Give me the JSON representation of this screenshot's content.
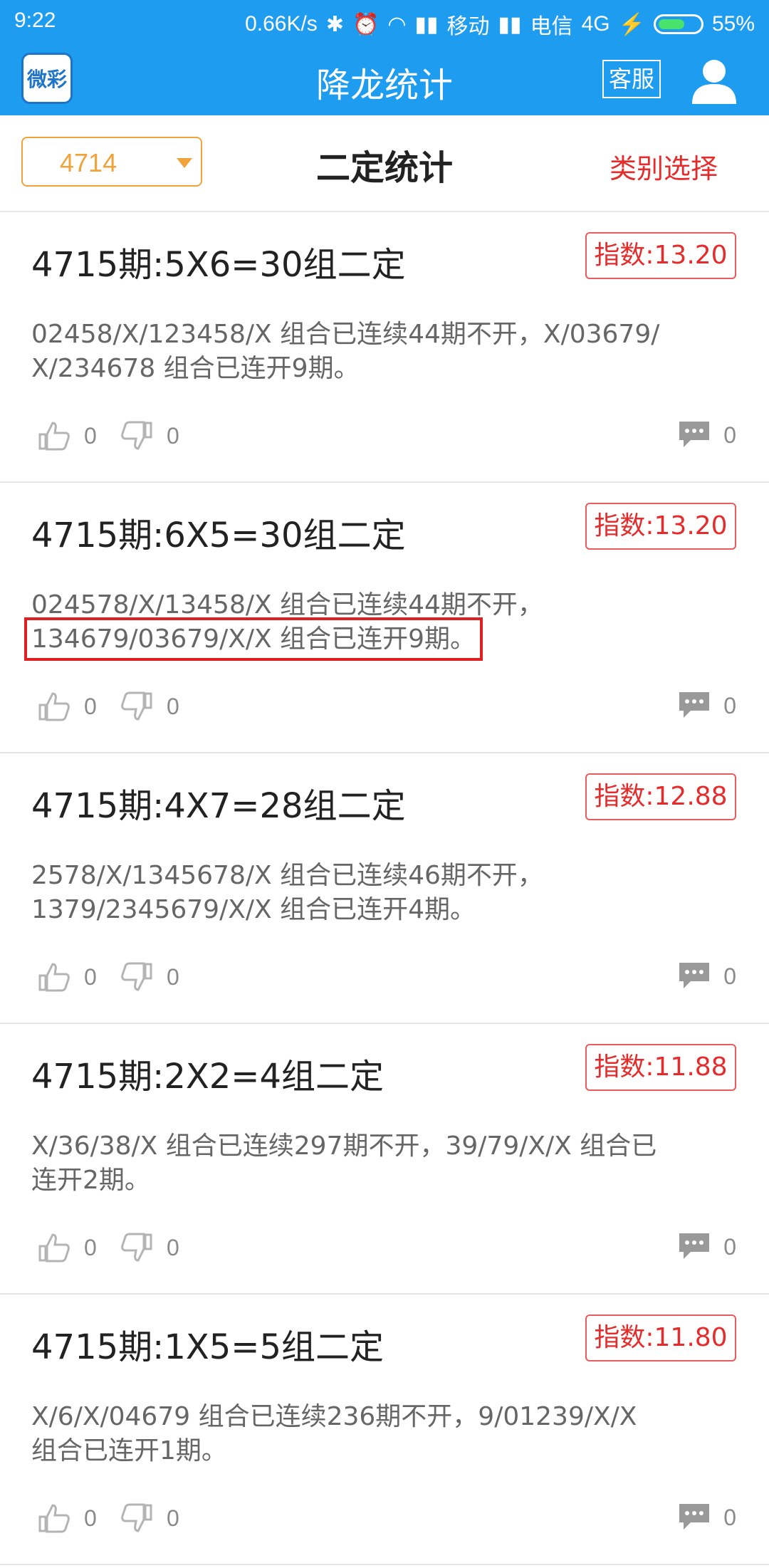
{
  "status_bar": {
    "time": "9:22",
    "speed": "0.66K/s",
    "carrier1": "移动",
    "carrier2": "电信",
    "network": "4G",
    "battery": "55%"
  },
  "app_bar": {
    "logo_text": "微彩",
    "title": "降龙统计",
    "service_label": "客服"
  },
  "toolbar": {
    "period_selected": "4714",
    "heading": "二定统计",
    "category_label": "类别选择"
  },
  "items": [
    {
      "title": "4715期:5X6=30组二定",
      "badge": "指数:13.20",
      "desc_line1": "02458/X/123458/X 组合已连续44期不开，X/03679/",
      "desc_line2": "X/234678 组合已连开9期。",
      "likes": "0",
      "dislikes": "0",
      "comments": "0"
    },
    {
      "title": "4715期:6X5=30组二定",
      "badge": "指数:13.20",
      "desc_line1": "024578/X/13458/X 组合已连续44期不开，",
      "desc_line2": "134679/03679/X/X 组合已连开9期。",
      "likes": "0",
      "dislikes": "0",
      "comments": "0"
    },
    {
      "title": "4715期:4X7=28组二定",
      "badge": "指数:12.88",
      "desc_line1": "2578/X/1345678/X 组合已连续46期不开，",
      "desc_line2": "1379/2345679/X/X 组合已连开4期。",
      "likes": "0",
      "dislikes": "0",
      "comments": "0"
    },
    {
      "title": "4715期:2X2=4组二定",
      "badge": "指数:11.88",
      "desc_line1": "X/36/38/X 组合已连续297期不开，39/79/X/X 组合已",
      "desc_line2": "连开2期。",
      "likes": "0",
      "dislikes": "0",
      "comments": "0"
    },
    {
      "title": "4715期:1X5=5组二定",
      "badge": "指数:11.80",
      "desc_line1": "X/6/X/04679 组合已连续236期不开，9/01239/X/X",
      "desc_line2": "组合已连开1期。",
      "likes": "0",
      "dislikes": "0",
      "comments": "0"
    }
  ],
  "colors": {
    "primary": "#1e9df0",
    "accent_orange": "#f0a33a",
    "accent_red": "#e52b2b",
    "highlight_box": "#e02020"
  }
}
